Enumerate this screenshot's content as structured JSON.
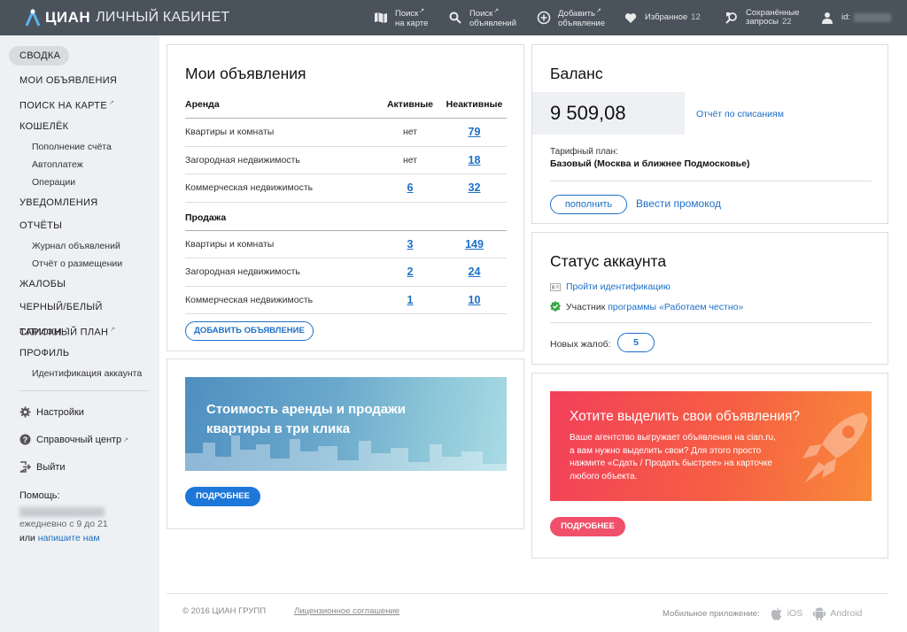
{
  "header": {
    "brand": "ЦИАН",
    "subtitle": "ЛИЧНЫЙ КАБИНЕТ",
    "nav": [
      {
        "line1": "Поиск",
        "line2": "на карте",
        "sup": "↗",
        "icon": "map-icon"
      },
      {
        "line1": "Поиск",
        "line2": "объявлений",
        "sup": "↗",
        "icon": "search-icon"
      },
      {
        "line1": "Добавить",
        "line2": "объявление",
        "sup": "↗",
        "icon": "add-circle-icon"
      },
      {
        "line1": "Избранное",
        "count": "12",
        "icon": "heart-icon"
      },
      {
        "line1": "Сохранённые",
        "line2": "запросы",
        "count": "22",
        "icon": "saved-search-icon"
      },
      {
        "line1": "id:",
        "icon": "user-icon"
      }
    ]
  },
  "sidebar": {
    "active": "СВОДКА",
    "items": [
      {
        "label": "МОИ ОБЪЯВЛЕНИЯ"
      },
      {
        "label": "ПОИСК НА КАРТЕ",
        "sup": "↗"
      },
      {
        "label": "КОШЕЛЁК"
      },
      {
        "label": "УВЕДОМЛЕНИЯ"
      },
      {
        "label": "ОТЧЁТЫ"
      },
      {
        "label": "ЖАЛОБЫ"
      },
      {
        "label": "ЧЕРНЫЙ/БЕЛЫЙ СПИСКИ",
        "sup": "↗"
      },
      {
        "label": "ТАРИФНЫЙ ПЛАН",
        "sup": "↗"
      },
      {
        "label": "ПРОФИЛЬ"
      }
    ],
    "wallet_sub": [
      "Пополнение счёта",
      "Автоплатеж",
      "Операции"
    ],
    "reports_sub": [
      "Журнал объявлений",
      "Отчёт о размещении"
    ],
    "profile_sub": [
      "Идентификация аккаунта"
    ],
    "settings": "Настройки",
    "help_center": "Справочный центр",
    "help_center_sup": "↗",
    "logout": "Выйти",
    "help_label": "Помощь:",
    "help_hours": "ежедневно с 9 до 21",
    "help_or": "или",
    "help_write": "напишите нам"
  },
  "listings": {
    "title": "Мои объявления",
    "col_active": "Активные",
    "col_inactive": "Неактивные",
    "rent_label": "Аренда",
    "rent_rows": [
      {
        "label": "Квартиры и комнаты",
        "active": "нет",
        "inactive": "79"
      },
      {
        "label": "Загородная недвижимость",
        "active": "нет",
        "inactive": "18"
      },
      {
        "label": "Коммерческая недвижимость",
        "active": "6",
        "inactive": "32"
      }
    ],
    "sale_label": "Продажа",
    "sale_rows": [
      {
        "label": "Квартиры и комнаты",
        "active": "3",
        "inactive": "149"
      },
      {
        "label": "Загородная недвижимость",
        "active": "2",
        "inactive": "24"
      },
      {
        "label": "Коммерческая недвижимость",
        "active": "1",
        "inactive": "10"
      }
    ],
    "add_button": "ДОБАВИТЬ ОБЪЯВЛЕНИЕ"
  },
  "rent_banner": {
    "text": "Стоимость аренды и продажи квартиры в три клика",
    "button": "ПОДРОБНЕЕ",
    "button_color": "#1d77d9"
  },
  "balance": {
    "title": "Баланс",
    "amount": "9 509,08",
    "report_link": "Отчёт по списаниям",
    "tariff_label": "Тарифный план:",
    "tariff_value": "Базовый (Москва и ближнее Подмосковье)",
    "topup_button": "пополнить",
    "promo_link": "Ввести промокод"
  },
  "status": {
    "title": "Статус аккаунта",
    "identify_link": "Пройти идентификацию",
    "member_prefix": "Участник",
    "member_link": "программы «Работаем честно»",
    "complaints_label": "Новых жалоб:",
    "complaints_count": "5"
  },
  "promo": {
    "title": "Хотите выделить свои объявления?",
    "desc": "Ваше агентство выгружает объявления на cian.ru, а вам нужно выделить свои? Для этого просто нажмите «Сдать / Продать быстрее» на карточке любого объекта.",
    "button": "ПОДРОБНЕЕ",
    "button_color": "#f0506a"
  },
  "footer": {
    "copyright": "© 2016 ЦИАН ГРУПП",
    "license": "Лицензионное соглашение",
    "mobile_label": "Мобильное приложение:",
    "ios": "iOS",
    "android": "Android"
  },
  "colors": {
    "header_bg": "#4a525b",
    "link": "#1d6fc7",
    "page_bg": "#eef0f3"
  }
}
